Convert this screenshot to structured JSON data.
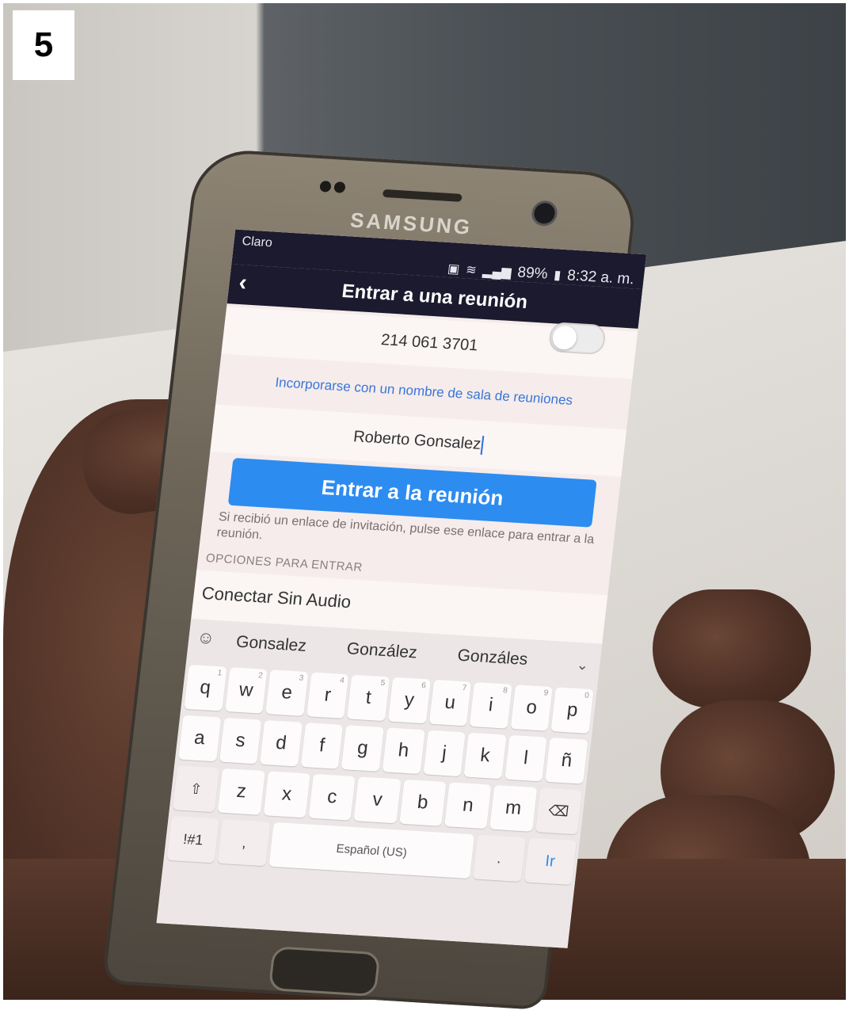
{
  "step_number": "5",
  "phone": {
    "brand": "SAMSUNG"
  },
  "status_bar": {
    "carrier": "Claro",
    "battery": "89%",
    "time": "8:32 a. m."
  },
  "app_bar": {
    "title": "Entrar a una reunión"
  },
  "form": {
    "meeting_id": "214 061 3701",
    "room_name_link": "Incorporarse con un nombre de sala de reuniones",
    "display_name": "Roberto Gonsalez",
    "join_button": "Entrar a la reunión",
    "hint": "Si recibió un enlace de invitación, pulse ese enlace para entrar a la reunión.",
    "options_header": "OPCIONES PARA ENTRAR",
    "audio_option": {
      "label": "Conectar Sin Audio",
      "enabled": false
    }
  },
  "keyboard": {
    "suggestions": [
      "Gonsalez",
      "González",
      "Gonzáles"
    ],
    "row1": [
      {
        "k": "q",
        "n": "1"
      },
      {
        "k": "w",
        "n": "2"
      },
      {
        "k": "e",
        "n": "3"
      },
      {
        "k": "r",
        "n": "4"
      },
      {
        "k": "t",
        "n": "5"
      },
      {
        "k": "y",
        "n": "6"
      },
      {
        "k": "u",
        "n": "7"
      },
      {
        "k": "i",
        "n": "8"
      },
      {
        "k": "o",
        "n": "9"
      },
      {
        "k": "p",
        "n": "0"
      }
    ],
    "row2": [
      "a",
      "s",
      "d",
      "f",
      "g",
      "h",
      "j",
      "k",
      "l",
      "ñ"
    ],
    "row3": [
      "z",
      "x",
      "c",
      "v",
      "b",
      "n",
      "m"
    ],
    "symbols_key": "!#1",
    "comma_key": ",",
    "space_key": "Español (US)",
    "period_key": ".",
    "go_key": "Ir"
  }
}
